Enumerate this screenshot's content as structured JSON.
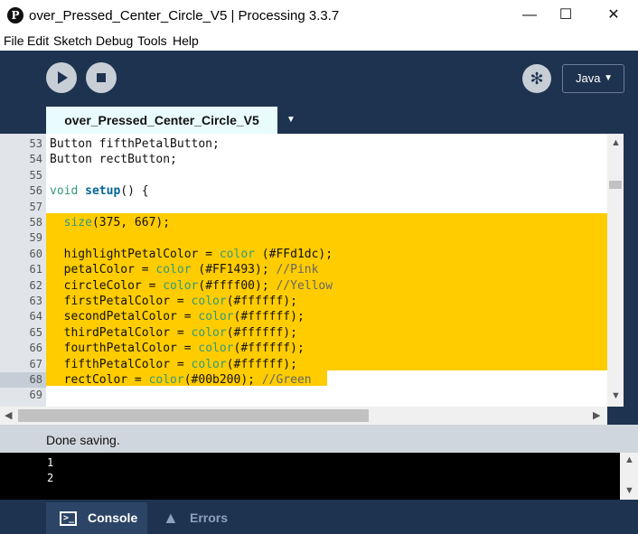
{
  "window": {
    "app_logo": "P",
    "title": "over_Pressed_Center_Circle_V5 | Processing 3.3.7",
    "controls": {
      "minimize": "—",
      "maximize": "☐",
      "close": "✕"
    }
  },
  "menu": [
    "File",
    "Edit",
    "Sketch",
    "Debug",
    "Tools",
    "Help"
  ],
  "toolbar": {
    "run_icon": "play-icon",
    "stop_icon": "stop-icon",
    "debug_icon": "butterfly-icon",
    "mode_label": "Java",
    "mode_caret": "▼"
  },
  "tabs": {
    "active": "over_Pressed_Center_Circle_V5",
    "menu_caret": "▼"
  },
  "editor": {
    "current_line": 68,
    "selection_color": "#ffcc00",
    "lines": [
      {
        "num": "53",
        "text": "Button fifthPetalButton;"
      },
      {
        "num": "54",
        "text": "Button rectButton;"
      },
      {
        "num": "55",
        "text": ""
      },
      {
        "num": "56",
        "text": "void setup() {"
      },
      {
        "num": "57",
        "text": ""
      },
      {
        "num": "58",
        "text": "  size(375, 667);"
      },
      {
        "num": "59",
        "text": ""
      },
      {
        "num": "60",
        "text": "  highlightPetalColor = color (#FFd1dc);"
      },
      {
        "num": "61",
        "text": "  petalColor = color (#FF1493); //Pink"
      },
      {
        "num": "62",
        "text": "  circleColor = color(#ffff00); //Yellow"
      },
      {
        "num": "63",
        "text": "  firstPetalColor = color(#ffffff);"
      },
      {
        "num": "64",
        "text": "  secondPetalColor = color(#ffffff);"
      },
      {
        "num": "65",
        "text": "  thirdPetalColor = color(#ffffff);"
      },
      {
        "num": "66",
        "text": "  fourthPetalColor = color(#ffffff);"
      },
      {
        "num": "67",
        "text": "  fifthPetalColor = color(#ffffff);"
      },
      {
        "num": "68",
        "text": "  rectColor = color(#00b200); //Green"
      },
      {
        "num": "69",
        "text": ""
      }
    ]
  },
  "status": {
    "message": "Done saving."
  },
  "console": {
    "lines": [
      "1",
      "2"
    ]
  },
  "bottom_tabs": {
    "console": "Console",
    "errors": "Errors"
  },
  "colors": {
    "toolbar_bg": "#1e3350",
    "tab_bg": "#e9fbfd",
    "keyword": "#33997e",
    "function": "#006699",
    "comment": "#666666"
  }
}
